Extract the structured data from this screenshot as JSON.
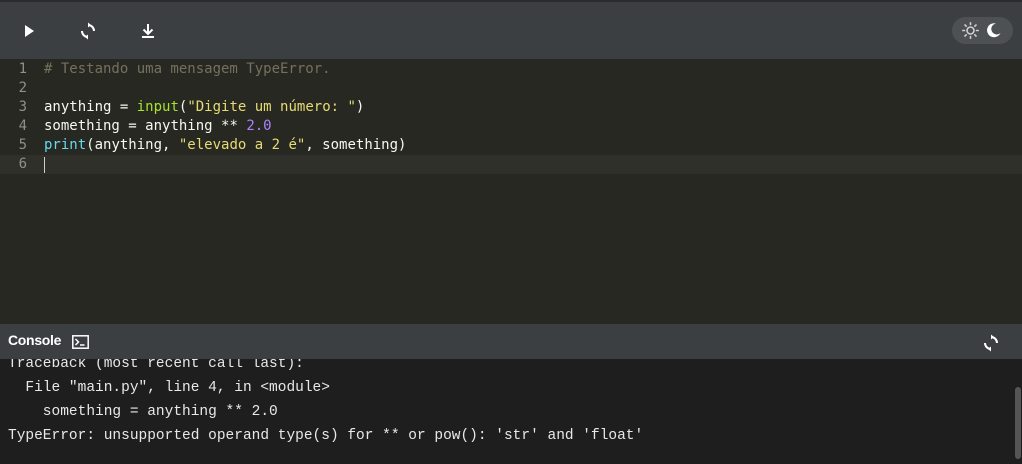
{
  "toolbar": {
    "run_icon": "play-icon",
    "reset_icon": "refresh-icon",
    "download_icon": "download-icon",
    "theme_light_icon": "sun-icon",
    "theme_dark_icon": "moon-icon"
  },
  "editor": {
    "lines": [
      {
        "number": "1",
        "text": "# Testando uma mensagem TypeError."
      },
      {
        "number": "2",
        "text": ""
      },
      {
        "number": "3",
        "text": "anything = input(\"Digite um número: \")"
      },
      {
        "number": "4",
        "text": "something = anything ** 2.0"
      },
      {
        "number": "5",
        "text": "print(anything, \"elevado a 2 é\", something)"
      },
      {
        "number": "6",
        "text": ""
      }
    ],
    "tokens": {
      "l1_comment": "# Testando uma mensagem TypeError.",
      "l3_var": "anything",
      "l3_eq": " = ",
      "l3_fn": "input",
      "l3_open": "(",
      "l3_str": "\"Digite um número: \"",
      "l3_close": ")",
      "l4_var": "something",
      "l4_eq": " = ",
      "l4_var2": "anything",
      "l4_op": " ** ",
      "l4_num": "2.0",
      "l5_fn": "print",
      "l5_open": "(anything, ",
      "l5_str": "\"elevado a 2 é\"",
      "l5_rest": ", something)"
    }
  },
  "console": {
    "title": "Console",
    "terminal_icon": "terminal-icon",
    "reset_icon": "refresh-icon",
    "output": [
      "Traceback (most recent call last):",
      "  File \"main.py\", line 4, in <module>",
      "    something = anything ** 2.0",
      "TypeError: unsupported operand type(s) for ** or pow(): 'str' and 'float'"
    ]
  },
  "colors": {
    "editor_bg": "#272822",
    "toolbar_bg": "#3c3f41",
    "console_bg": "#1e1e1e"
  }
}
